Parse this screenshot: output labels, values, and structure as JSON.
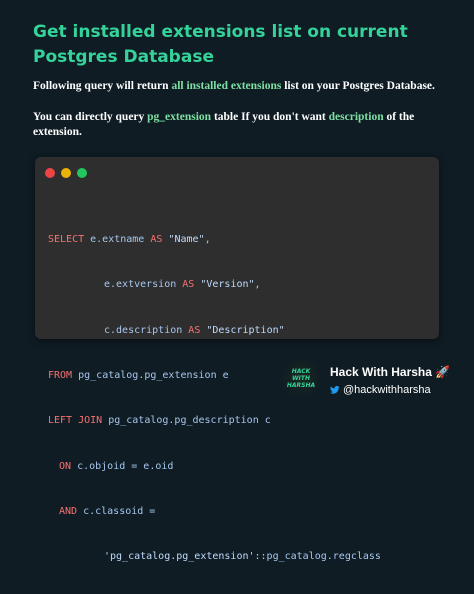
{
  "title": "Get installed extensions list on current Postgres Database",
  "para1": {
    "before": "Following query will return ",
    "highlight": "all installed extensions",
    "after": " list on your Postgres Database."
  },
  "para2": {
    "before": "You can directly query ",
    "highlight1": "pg_extension",
    "middle": " table If you don't want ",
    "highlight2": "description",
    "after": " of the extension."
  },
  "code_window": {
    "dot_colors": [
      "#ef4444",
      "#eab308",
      "#22c55e"
    ],
    "lines": [
      {
        "kw": "SELECT",
        "rest": " e.extname ",
        "kw2": "AS",
        "str": " \"Name\"",
        "tail": ","
      },
      {
        "rest": "e.extversion ",
        "kw2": "AS",
        "str": " \"Version\"",
        "tail": ","
      },
      {
        "rest": "c.description ",
        "kw2": "AS",
        "str": " \"Description\""
      },
      {
        "kw": "FROM",
        "rest": " pg_catalog.pg_extension e"
      },
      {
        "kw": "LEFT JOIN",
        "rest": " pg_catalog.pg_description c"
      },
      {
        "kw": "ON",
        "rest": " c.objoid = e.oid"
      },
      {
        "kw": "AND",
        "rest": " c.classoid ="
      },
      {
        "str": "'pg_catalog.pg_extension'",
        "rest": "::pg_catalog.regclass"
      }
    ]
  },
  "footer": {
    "logo_text": [
      "HACK",
      "WITH",
      "HARSHA"
    ],
    "brand": "Hack With Harsha 🚀",
    "handle": "@hackwithharsha",
    "twitter_color": "#1d9bf0"
  }
}
